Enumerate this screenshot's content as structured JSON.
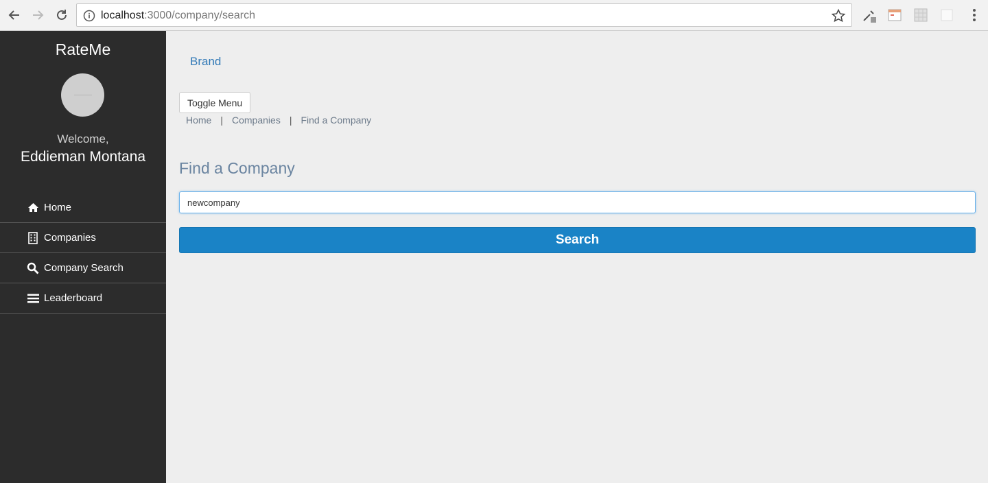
{
  "browser": {
    "url_host": "localhost",
    "url_path": ":3000/company/search"
  },
  "sidebar": {
    "app_title": "RateMe",
    "welcome": "Welcome,",
    "username": "Eddieman Montana",
    "items": [
      {
        "label": "Home",
        "icon": "home-icon"
      },
      {
        "label": "Companies",
        "icon": "building-icon"
      },
      {
        "label": "Company Search",
        "icon": "search-icon"
      },
      {
        "label": "Leaderboard",
        "icon": "list-icon"
      }
    ]
  },
  "main": {
    "brand": "Brand",
    "toggle_label": "Toggle Menu",
    "breadcrumb": {
      "items": [
        "Home",
        "Companies",
        "Find a Company"
      ],
      "separator": "|"
    },
    "title": "Find a Company",
    "search_value": "newcompany",
    "search_button": "Search"
  },
  "colors": {
    "sidebar_bg": "#2c2c2c",
    "accent": "#1a83c6",
    "link": "#337ab7"
  }
}
